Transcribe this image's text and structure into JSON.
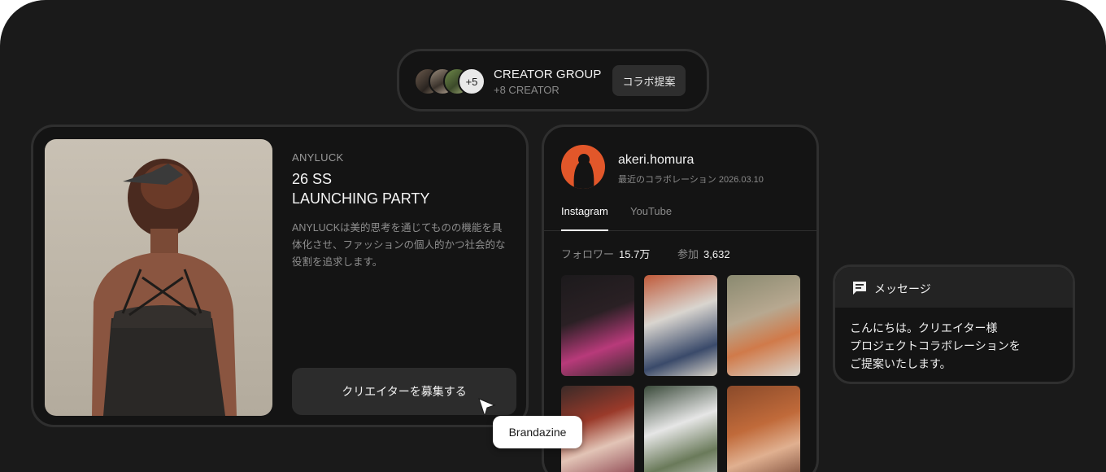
{
  "group": {
    "title": "CREATOR GROUP",
    "subtitle": "+8 CREATOR",
    "more_count": "+5",
    "collab_button": "コラボ提案"
  },
  "event": {
    "brand": "ANYLUCK",
    "title_line1": "26 SS",
    "title_line2": "LAUNCHING PARTY",
    "description": "ANYLUCKは美的思考を通じてものの機能を具体化させ、ファッションの個人的かつ社会的な役割を追求します。",
    "recruit_button": "クリエイターを募集する"
  },
  "tooltip": {
    "label": "Brandazine"
  },
  "profile": {
    "handle": "akeri.homura",
    "last_collab": "最近のコラボレーション 2026.03.10",
    "tabs": [
      "Instagram",
      "YouTube"
    ],
    "active_tab": "Instagram",
    "followers_label": "フォロワー",
    "followers_value": "15.7万",
    "participation_label": "参加",
    "participation_value": "3,632"
  },
  "message": {
    "title": "メッセージ",
    "line1": "こんにちは。クリエイター様",
    "line2": "プロジェクトコラボレーションを",
    "line3": "ご提案いたします。"
  },
  "colors": {
    "background": "#1a1a1a",
    "card": "#141414",
    "border": "#2f2f2f",
    "button": "#2c2c2c",
    "avatar_accent": "#e2572a"
  }
}
